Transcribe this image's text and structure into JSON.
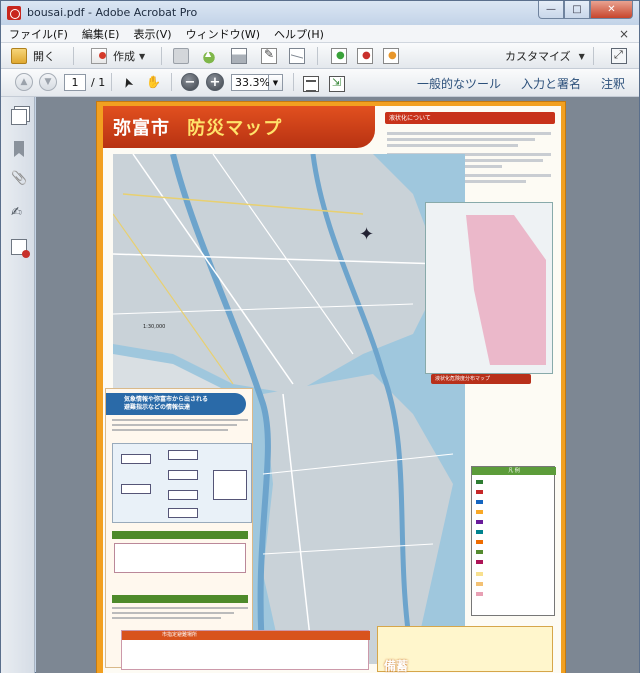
{
  "window": {
    "title": "bousai.pdf - Adobe Acrobat Pro",
    "minimize": "—",
    "maximize": "□",
    "close": "✕"
  },
  "menu": {
    "items": [
      "ファイル(F)",
      "編集(E)",
      "表示(V)",
      "ウィンドウ(W)",
      "ヘルプ(H)"
    ],
    "close": "×"
  },
  "toolbar1": {
    "open_label": "開く",
    "create_label": "作成",
    "customize_label": "カスタマイズ"
  },
  "toolbar2": {
    "page_current": "1",
    "page_total": "/ 1",
    "zoom_value": "33.3%",
    "tools_link": "一般的なツール",
    "fill_sign_link": "入力と署名",
    "comment_link": "注釈"
  },
  "document": {
    "map_title_a": "弥富市",
    "map_title_b": "防災マップ",
    "right_section_heading": "液状化について",
    "inset_caption": "液状化危険度分布マップ",
    "info_heading_line1": "気象情報や弥富市から出される",
    "info_heading_line2": "避難指示などの情報伝達",
    "legend_title": "凡 例",
    "bottom_table_title": "市指定避難場所",
    "bottom_right_title": "備蓄",
    "scale_text": "1:30,000"
  },
  "colors": {
    "banner": "#c83a16",
    "page_border": "#f2a020",
    "info_blue": "#2a6aa8",
    "legend_green": "#5c9c3a"
  }
}
